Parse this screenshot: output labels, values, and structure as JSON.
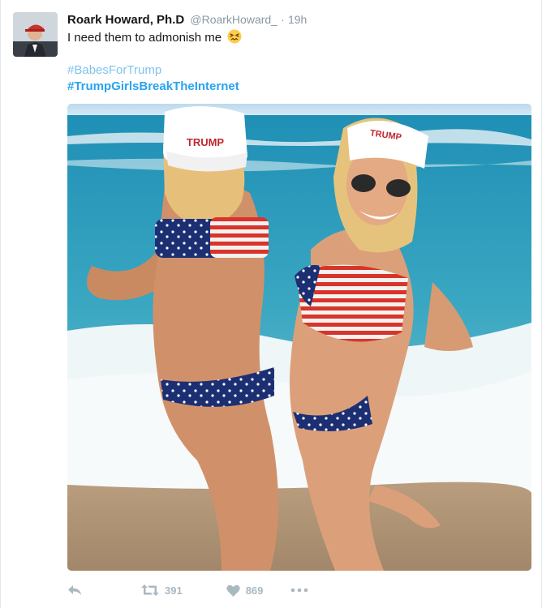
{
  "tweet": {
    "fullname": "Roark Howard, Ph.D",
    "handle": "@RoarkHoward_",
    "separator": "·",
    "time": "19h",
    "text": "I need them to admonish me",
    "emoji": "confounded-face-emoji",
    "hashtags": [
      "#BabesForTrump",
      "#TrumpGirlsBreakTheInternet"
    ]
  },
  "media": {
    "description_icon": "photo",
    "hat_text": "TRUMP"
  },
  "actions": {
    "reply_icon": "reply-icon",
    "retweet_icon": "retweet-icon",
    "retweet_count": "391",
    "like_icon": "heart-icon",
    "like_count": "869",
    "more_icon": "more-icon"
  },
  "colors": {
    "link": "#1da1f2",
    "muted": "#8899a6",
    "action": "#aab8c2"
  }
}
